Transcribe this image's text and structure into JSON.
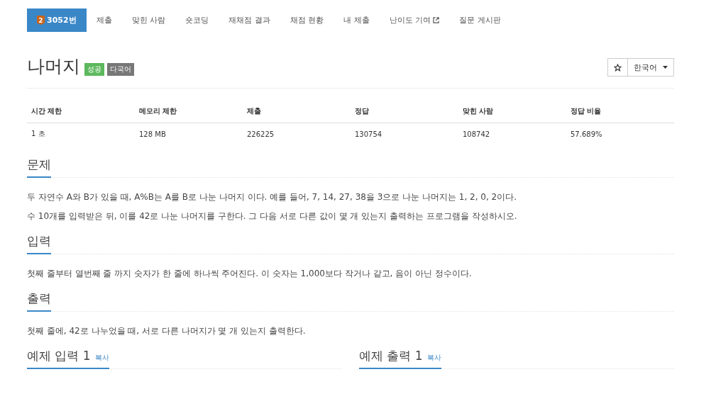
{
  "nav": [
    {
      "label": "3052번",
      "badge": "2",
      "selected": true,
      "external": false
    },
    {
      "label": "제출",
      "selected": false,
      "external": false
    },
    {
      "label": "맞힌 사람",
      "selected": false,
      "external": false
    },
    {
      "label": "숏코딩",
      "selected": false,
      "external": false
    },
    {
      "label": "재채점 결과",
      "selected": false,
      "external": false
    },
    {
      "label": "채점 현황",
      "selected": false,
      "external": false
    },
    {
      "label": "내 제출",
      "selected": false,
      "external": false
    },
    {
      "label": "난이도 기여",
      "selected": false,
      "external": true
    },
    {
      "label": "질문 게시판",
      "selected": false,
      "external": false
    }
  ],
  "title": "나머지",
  "labels": [
    {
      "text": "성공",
      "color": "#5cb85c"
    },
    {
      "text": "다국어",
      "color": "#777777"
    }
  ],
  "language": "한국어",
  "table": {
    "columns": [
      "시간 제한",
      "메모리 제한",
      "제출",
      "정답",
      "맞힌 사람",
      "정답 비율"
    ],
    "rows": [
      [
        "1 초",
        "128 MB",
        "226225",
        "130754",
        "108742",
        "57.689%"
      ]
    ]
  },
  "sections": [
    {
      "heading": "문제",
      "paragraphs": [
        "두 자연수 A와 B가 있을 때, A%B는 A를 B로 나눈 나머지 이다. 예를 들어, 7, 14, 27, 38을 3으로 나눈 나머지는 1, 2, 0, 2이다.",
        "수 10개를 입력받은 뒤, 이를 42로 나눈 나머지를 구한다. 그 다음 서로 다른 값이 몇 개 있는지 출력하는 프로그램을 작성하시오."
      ]
    },
    {
      "heading": "입력",
      "paragraphs": [
        "첫째 줄부터 열번째 줄 까지 숫자가 한 줄에 하나씩 주어진다. 이 숫자는 1,000보다 작거나 같고, 음이 아닌 정수이다."
      ]
    },
    {
      "heading": "출력",
      "paragraphs": [
        "첫째 줄에, 42로 나누었을 때, 서로 다른 나머지가 몇 개 있는지 출력한다."
      ]
    }
  ],
  "examples": [
    {
      "heading": "예제 입력 1",
      "copy": "복사"
    },
    {
      "heading": "예제 출력 1",
      "copy": "복사"
    }
  ]
}
